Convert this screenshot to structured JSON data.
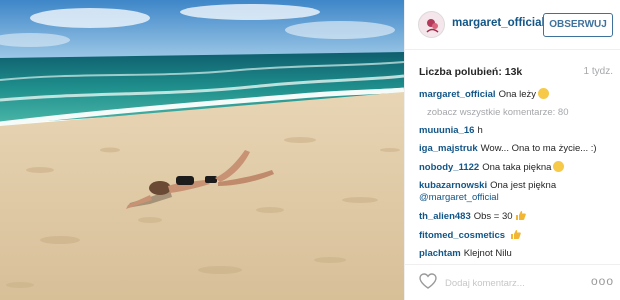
{
  "post": {
    "image_alt": "",
    "username": "margaret_official",
    "follow_label": "OBSERWUJ",
    "likes_text": "Liczba polubień: 13k",
    "time_text": "1 tydz.",
    "caption": {
      "user": "margaret_official",
      "text": "Ona leży"
    },
    "view_all_comments": "zobacz wszystkie komentarze: 80",
    "comments": [
      {
        "user": "muuunia_16",
        "text": "h"
      },
      {
        "user": "iga_majstruk",
        "text": "Wow... Ona to ma życie... :)"
      },
      {
        "user": "nobody_1122",
        "text": "Ona taka piękna"
      },
      {
        "user": "kubazarnowski",
        "text": "Ona jest piękna",
        "mention": "@margaret_official"
      },
      {
        "user": "th_alien483",
        "text": "Obs = 30"
      },
      {
        "user": "fitomed_cosmetics",
        "text": ""
      },
      {
        "user": "plachtam",
        "text": "Klejnot Nilu"
      }
    ],
    "comment_placeholder": "Dodaj komentarz...",
    "more_label": "ooo"
  },
  "icons": {
    "like": "heart-outline-icon",
    "more": "more-dots-icon",
    "avatar": "profile-avatar"
  },
  "colors": {
    "username": "#125688",
    "follow_border": "#3f729b",
    "muted": "#a5a7aa",
    "divider": "#efefef"
  }
}
